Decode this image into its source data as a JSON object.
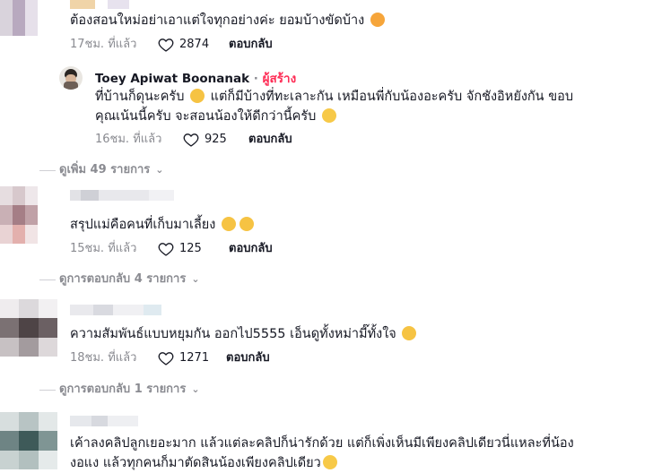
{
  "colors": {
    "creator_accent": "#fe2c55",
    "meta": "#8a8b91",
    "text": "#161823"
  },
  "comments": [
    {
      "text": "ต้องสอนใหม่อย่าเอาแต่ใจทุกอย่างค่ะ ยอมบ้างขัดบ้าง",
      "time": "17ชม. ที่แล้ว",
      "likes": "2874",
      "reply_label": "ตอบกลับ",
      "emoji_icon": "smiling-hearts-emoji-icon"
    },
    {
      "text": "สรุปแม่คือคนที่เก็บมาเลี้ยง",
      "time": "15ชม. ที่แล้ว",
      "likes": "125",
      "reply_label": "ตอบกลับ",
      "more_replies": "ดูการตอบกลับ 4 รายการ"
    },
    {
      "text": "ความสัมพันธ์แบบหยุมกัน ออกไป5555 เอ็นดูทั้งหม่ามี๊ทั้งใจ",
      "time": "18ชม. ที่แล้ว",
      "likes": "1271",
      "reply_label": "ตอบกลับ",
      "more_replies": "ดูการตอบกลับ 1 รายการ"
    },
    {
      "text_line1": "เค้าลงคลิปลูกเยอะมาก แล้วแต่ละคลิปก็น่ารักด้วย แต่ก็เพิ่งเห็นมีเพียงคลิปเดียวนี่แหละที่น้อง",
      "text_line2": "งอแง แล้วทุกคนก็มาตัดสินน้องเพียงคลิปเดียว"
    }
  ],
  "creator_reply": {
    "author": "Toey Apiwat Boonanak",
    "separator": "·",
    "creator_badge": "ผู้สร้าง",
    "text_line1": "ที่บ้านก็ดุนะครับ",
    "text_line1b": "แต่ก็มีบ้างที่ทะเลาะกัน เหมือนพี่กับน้องอะครับ จักชังอิหยังกัน ขอบ",
    "text_line2": "คุณเน้นนี้ครับ จะสอนน้องให้ดีกว่านี้ครับ",
    "time": "16ชม. ที่แล้ว",
    "likes": "925",
    "reply_label": "ตอบกลับ"
  },
  "view_more": "ดูเพิ่ม 49 รายการ"
}
